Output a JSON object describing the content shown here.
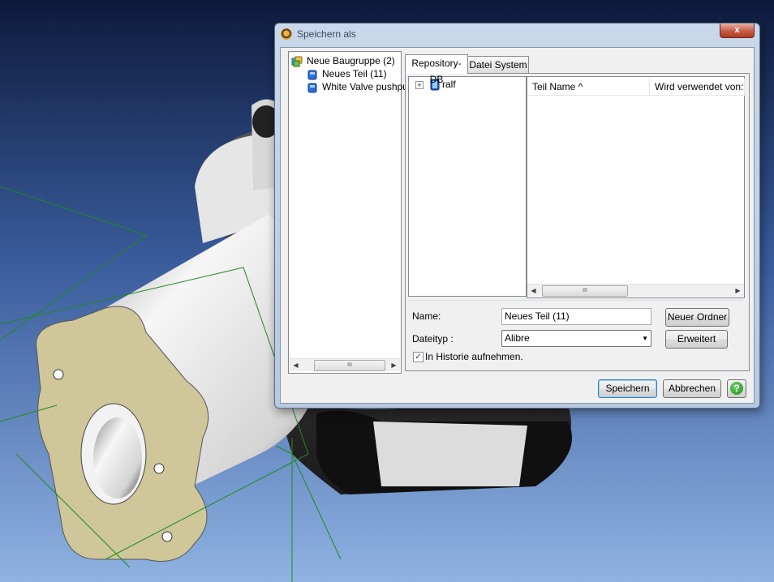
{
  "dialog": {
    "title": "Speichern als",
    "close_label": "x"
  },
  "assembly_tree": {
    "items": [
      {
        "label": "Neue Baugruppe (2)",
        "icon": "assembly-icon"
      },
      {
        "label": "Neues Teil (11)",
        "icon": "part-icon"
      },
      {
        "label": "White Valve pushpul",
        "icon": "part-icon"
      }
    ]
  },
  "tabs": [
    {
      "label": "Repository-DB",
      "active": true
    },
    {
      "label": "Datei System",
      "active": false
    }
  ],
  "repository_tree": {
    "expander": "+",
    "items": [
      {
        "label": "ralf",
        "icon": "repository-icon"
      }
    ]
  },
  "list": {
    "columns": [
      "Teil Name ^",
      "Wird verwendet von:"
    ],
    "rows": []
  },
  "form": {
    "name_label": "Name:",
    "name_value": "Neues Teil (11)",
    "filetype_label": "Dateityp :",
    "filetype_value": "Alibre",
    "history_label": "In Historie aufnehmen.",
    "history_checked": true,
    "new_folder_label": "Neuer Ordner",
    "advanced_label": "Erweitert"
  },
  "buttons": {
    "save_label": "Speichern",
    "cancel_label": "Abbrechen",
    "help_label": "?"
  },
  "scrollbar_thumb": "III",
  "colors": {
    "annotation_arrow": "#e8201a",
    "background_top": "#0e1b3d",
    "background_bottom": "#8aaee0",
    "part_face": "#cfc79a"
  }
}
